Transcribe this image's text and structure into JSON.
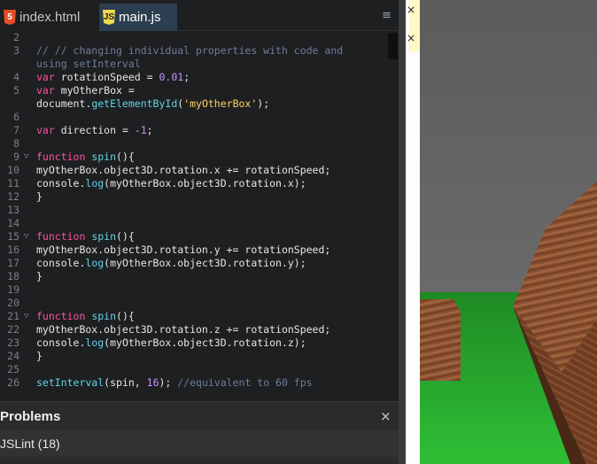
{
  "tabs": [
    {
      "label": "index.html",
      "icon": "html5-file-icon",
      "icon_glyph": "5",
      "active": false
    },
    {
      "label": "main.js",
      "icon": "javascript-file-icon",
      "icon_glyph": "JS",
      "active": true
    }
  ],
  "tabbar": {
    "menu_icon": "≡"
  },
  "code_lines": [
    {
      "n": "2",
      "fold": "",
      "segments": []
    },
    {
      "n": "3",
      "fold": "",
      "segments": [
        {
          "c": "com",
          "t": "// // changing individual properties with code and"
        }
      ]
    },
    {
      "n": "",
      "fold": "",
      "segments": [
        {
          "c": "com",
          "t": "using setInterval"
        }
      ]
    },
    {
      "n": "4",
      "fold": "",
      "segments": [
        {
          "c": "kw",
          "t": "var "
        },
        {
          "c": "plain",
          "t": "rotationSpeed = "
        },
        {
          "c": "num",
          "t": "0.01"
        },
        {
          "c": "plain",
          "t": ";"
        }
      ]
    },
    {
      "n": "5",
      "fold": "",
      "segments": [
        {
          "c": "kw",
          "t": "var "
        },
        {
          "c": "plain",
          "t": "myOtherBox ="
        }
      ]
    },
    {
      "n": "",
      "fold": "",
      "segments": [
        {
          "c": "plain",
          "t": "document."
        },
        {
          "c": "fn",
          "t": "getElementById"
        },
        {
          "c": "plain",
          "t": "("
        },
        {
          "c": "str",
          "t": "'myOtherBox'"
        },
        {
          "c": "plain",
          "t": ");"
        }
      ]
    },
    {
      "n": "6",
      "fold": "",
      "segments": []
    },
    {
      "n": "7",
      "fold": "",
      "segments": [
        {
          "c": "kw",
          "t": "var "
        },
        {
          "c": "plain",
          "t": "direction = "
        },
        {
          "c": "num",
          "t": "-1"
        },
        {
          "c": "plain",
          "t": ";"
        }
      ]
    },
    {
      "n": "8",
      "fold": "",
      "segments": []
    },
    {
      "n": "9",
      "fold": "▽",
      "segments": [
        {
          "c": "kw",
          "t": "function "
        },
        {
          "c": "fn",
          "t": "spin"
        },
        {
          "c": "plain",
          "t": "(){"
        }
      ]
    },
    {
      "n": "10",
      "fold": "",
      "segments": [
        {
          "c": "plain",
          "t": "myOtherBox.object3D.rotation.x += rotationSpeed;"
        }
      ]
    },
    {
      "n": "11",
      "fold": "",
      "segments": [
        {
          "c": "plain",
          "t": "console."
        },
        {
          "c": "fn",
          "t": "log"
        },
        {
          "c": "plain",
          "t": "(myOtherBox.object3D.rotation.x);"
        }
      ]
    },
    {
      "n": "12",
      "fold": "",
      "segments": [
        {
          "c": "plain",
          "t": "}"
        }
      ]
    },
    {
      "n": "13",
      "fold": "",
      "segments": []
    },
    {
      "n": "14",
      "fold": "",
      "segments": []
    },
    {
      "n": "15",
      "fold": "▽",
      "segments": [
        {
          "c": "kw",
          "t": "function "
        },
        {
          "c": "fn",
          "t": "spin"
        },
        {
          "c": "plain",
          "t": "(){"
        }
      ]
    },
    {
      "n": "16",
      "fold": "",
      "segments": [
        {
          "c": "plain",
          "t": "myOtherBox.object3D.rotation.y += rotationSpeed;"
        }
      ]
    },
    {
      "n": "17",
      "fold": "",
      "segments": [
        {
          "c": "plain",
          "t": "console."
        },
        {
          "c": "fn",
          "t": "log"
        },
        {
          "c": "plain",
          "t": "(myOtherBox.object3D.rotation.y);"
        }
      ]
    },
    {
      "n": "18",
      "fold": "",
      "segments": [
        {
          "c": "plain",
          "t": "}"
        }
      ]
    },
    {
      "n": "19",
      "fold": "",
      "segments": []
    },
    {
      "n": "20",
      "fold": "",
      "segments": []
    },
    {
      "n": "21",
      "fold": "▽",
      "segments": [
        {
          "c": "kw",
          "t": "function "
        },
        {
          "c": "fn",
          "t": "spin"
        },
        {
          "c": "plain",
          "t": "(){"
        }
      ]
    },
    {
      "n": "22",
      "fold": "",
      "segments": [
        {
          "c": "plain",
          "t": "myOtherBox.object3D.rotation.z += rotationSpeed;"
        }
      ]
    },
    {
      "n": "23",
      "fold": "",
      "segments": [
        {
          "c": "plain",
          "t": "console."
        },
        {
          "c": "fn",
          "t": "log"
        },
        {
          "c": "plain",
          "t": "(myOtherBox.object3D.rotation.z);"
        }
      ]
    },
    {
      "n": "24",
      "fold": "",
      "segments": [
        {
          "c": "plain",
          "t": "}"
        }
      ]
    },
    {
      "n": "25",
      "fold": "",
      "segments": []
    },
    {
      "n": "26",
      "fold": "",
      "segments": [
        {
          "c": "fn",
          "t": "setInterval"
        },
        {
          "c": "plain",
          "t": "(spin, "
        },
        {
          "c": "num",
          "t": "16"
        },
        {
          "c": "plain",
          "t": "); "
        },
        {
          "c": "com",
          "t": "//equivalent to 60 fps"
        }
      ]
    }
  ],
  "problems": {
    "title": "Problems",
    "close_icon": "×",
    "linter": "JSLint (18)"
  },
  "notes_panel": {
    "close_icon": "×"
  },
  "colors": {
    "keyword": "#ff4fa0",
    "number": "#c792ff",
    "string": "#ffd75e",
    "comment": "#6f7d9a",
    "function": "#64d2e6",
    "active_tab": "#2d3e50"
  }
}
